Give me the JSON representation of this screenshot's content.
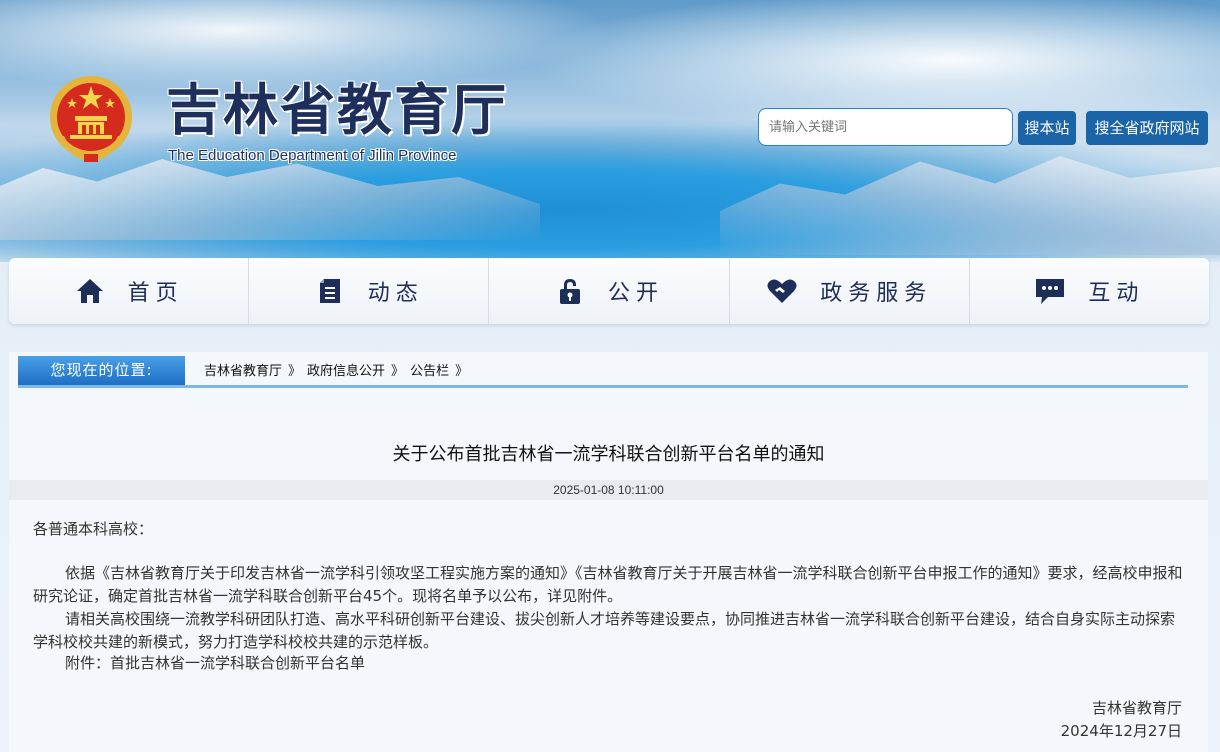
{
  "header": {
    "title": "吉林省教育厅",
    "subtitle": "The Education Department of Jilin Province",
    "search_placeholder": "请输入关键词",
    "search_site_label": "搜本站",
    "search_gov_label": "搜全省政府网站"
  },
  "nav": {
    "items": [
      {
        "label": "首页",
        "icon": "home-icon"
      },
      {
        "label": "动态",
        "icon": "document-icon"
      },
      {
        "label": "公开",
        "icon": "lock-icon"
      },
      {
        "label": "政务服务",
        "icon": "handshake-heart-icon"
      },
      {
        "label": "互动",
        "icon": "chat-icon"
      }
    ]
  },
  "location": {
    "label": "您现在的位置:",
    "breadcrumbs": [
      "吉林省教育厅",
      "政府信息公开",
      "公告栏"
    ],
    "separator": "》"
  },
  "article": {
    "title": "关于公布首批吉林省一流学科联合创新平台名单的通知",
    "datetime": "2025-01-08 10:11:00",
    "salutation": "各普通本科高校：",
    "paragraphs": [
      "依据《吉林省教育厅关于印发吉林省一流学科引领攻坚工程实施方案的通知》《吉林省教育厅关于开展吉林省一流学科联合创新平台申报工作的通知》要求，经高校申报和研究论证，确定首批吉林省一流学科联合创新平台45个。现将名单予以公布，详见附件。",
      "请相关高校围绕一流教学科研团队打造、高水平科研创新平台建设、拔尖创新人才培养等建设要点，协同推进吉林省一流学科联合创新平台建设，结合自身实际主动探索学科校校共建的新模式，努力打造学科校校共建的示范样板。",
      "附件：首批吉林省一流学科联合创新平台名单"
    ],
    "signature_org": "吉林省教育厅",
    "signature_date": "2024年12月27日"
  },
  "colors": {
    "brand_dark": "#1f2f5c",
    "button_blue": "#1c64a8",
    "location_blue": "#1d6fc4"
  }
}
